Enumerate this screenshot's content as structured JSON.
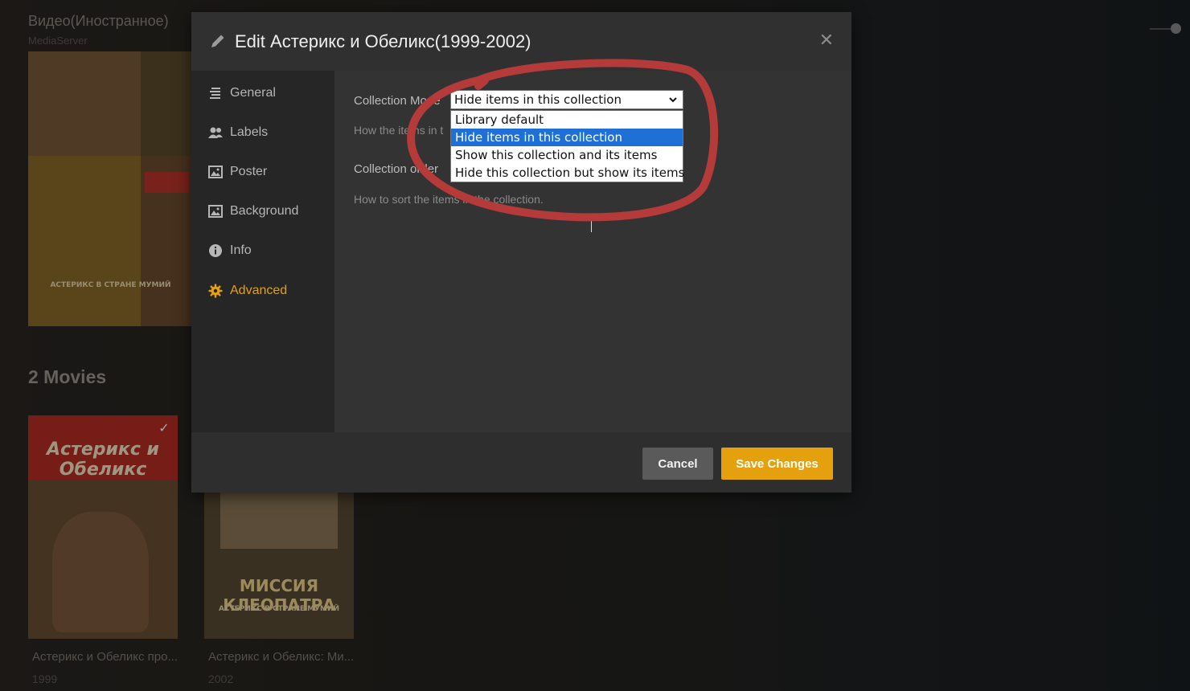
{
  "background": {
    "library_title": "Видео(Иностранное)",
    "server": "MediaServer",
    "collage_band_text": "АСТЕРИКС В СТРАНЕ МУМИЙ",
    "movies_heading": "2 Movies",
    "movies": [
      {
        "poster_text": "Астерикс и Обеликс",
        "title": "Астерикс и Обеликс про...",
        "year": "1999"
      },
      {
        "poster_text": "МИССИЯ КЛЕОПАТРА",
        "title": "Астерикс и Обеликс: Ми...",
        "year": "2002"
      }
    ]
  },
  "modal": {
    "title": "Edit Астерикс и Обеликс(1999-2002)",
    "close_icon": "close-icon",
    "nav": [
      {
        "label": "General",
        "icon": "list-icon",
        "active": false
      },
      {
        "label": "Labels",
        "icon": "users-icon",
        "active": false
      },
      {
        "label": "Poster",
        "icon": "image-icon",
        "active": false
      },
      {
        "label": "Background",
        "icon": "image-icon",
        "active": false
      },
      {
        "label": "Info",
        "icon": "info-icon",
        "active": false
      },
      {
        "label": "Advanced",
        "icon": "gear-icon",
        "active": true
      }
    ],
    "advanced": {
      "collection_mode_label": "Collection Mode",
      "collection_mode_value": "Hide items in this collection",
      "collection_mode_hint": "How the items in t",
      "collection_mode_options": [
        "Library default",
        "Hide items in this collection",
        "Show this collection and its items",
        "Hide this collection but show its items"
      ],
      "collection_order_label": "Collection order",
      "collection_order_hint": "How to sort the items in the collection."
    },
    "buttons": {
      "cancel": "Cancel",
      "save": "Save Changes"
    }
  },
  "colors": {
    "accent": "#e5a00d",
    "selection": "#1e70d6",
    "annotation": "#b53a3a"
  }
}
